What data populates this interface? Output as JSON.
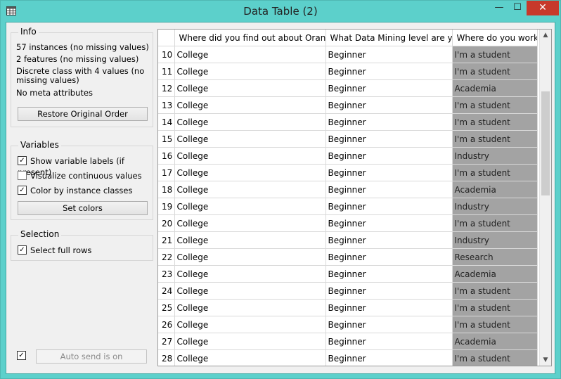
{
  "window": {
    "title": "Data Table (2)",
    "minimize_glyph": "—",
    "maximize_glyph": "☐",
    "close_glyph": "✕"
  },
  "info": {
    "title": "Info",
    "lines": [
      "57 instances (no missing values)",
      "2 features (no missing values)",
      "Discrete class with 4 values (no missing values)",
      "No meta attributes"
    ],
    "restore_button": "Restore Original Order"
  },
  "variables": {
    "title": "Variables",
    "show_labels": {
      "label": "Show variable labels (if present)",
      "checked": true
    },
    "visualize": {
      "label": "Visualize continuous values",
      "checked": false
    },
    "color_by_class": {
      "label": "Color by instance classes",
      "checked": true
    },
    "set_colors_button": "Set colors"
  },
  "selection": {
    "title": "Selection",
    "select_full_rows": {
      "label": "Select full rows",
      "checked": true
    }
  },
  "autosend": {
    "checked": true,
    "label": "Auto send is on"
  },
  "table": {
    "headers": [
      "",
      "Where did you find out about Orange?",
      "What Data Mining level are you?",
      "Where do you work?"
    ],
    "rows": [
      [
        "10",
        "College",
        "Beginner",
        "I'm a student"
      ],
      [
        "11",
        "College",
        "Beginner",
        "I'm a student"
      ],
      [
        "12",
        "College",
        "Beginner",
        "Academia"
      ],
      [
        "13",
        "College",
        "Beginner",
        "I'm a student"
      ],
      [
        "14",
        "College",
        "Beginner",
        "I'm a student"
      ],
      [
        "15",
        "College",
        "Beginner",
        "I'm a student"
      ],
      [
        "16",
        "College",
        "Beginner",
        "Industry"
      ],
      [
        "17",
        "College",
        "Beginner",
        "I'm a student"
      ],
      [
        "18",
        "College",
        "Beginner",
        "Academia"
      ],
      [
        "19",
        "College",
        "Beginner",
        "Industry"
      ],
      [
        "20",
        "College",
        "Beginner",
        "I'm a student"
      ],
      [
        "21",
        "College",
        "Beginner",
        "Industry"
      ],
      [
        "22",
        "College",
        "Beginner",
        "Research"
      ],
      [
        "23",
        "College",
        "Beginner",
        "Academia"
      ],
      [
        "24",
        "College",
        "Beginner",
        "I'm a student"
      ],
      [
        "25",
        "College",
        "Beginner",
        "I'm a student"
      ],
      [
        "26",
        "College",
        "Beginner",
        "I'm a student"
      ],
      [
        "27",
        "College",
        "Beginner",
        "Academia"
      ],
      [
        "28",
        "College",
        "Beginner",
        "I'm a student"
      ]
    ]
  },
  "colors": {
    "titlebar": "#5cd0cb",
    "class_cell": "#a3a3a3",
    "close_button": "#c7392b"
  }
}
